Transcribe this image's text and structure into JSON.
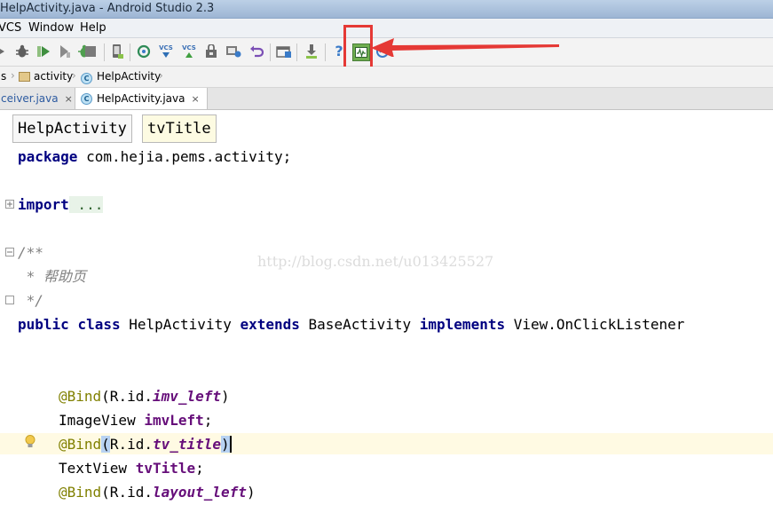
{
  "window": {
    "title": "HelpActivity.java - Android Studio 2.3"
  },
  "menu": {
    "vcs": "VCS",
    "window": "Window",
    "help": "Help"
  },
  "toolbar": {
    "vcs1": "VCS",
    "vcs2": "VCS",
    "help_glyph": "?"
  },
  "nav": {
    "crumb0": "s",
    "crumb1": "activity",
    "crumb2": "HelpActivity",
    "class_badge": "C"
  },
  "tabs": [
    {
      "label": "ceiver.java",
      "close": "×"
    },
    {
      "label": "HelpActivity.java",
      "close": "×",
      "badge": "C"
    }
  ],
  "editor": {
    "crumbs": [
      "HelpActivity",
      "tvTitle"
    ],
    "watermark": "http://blog.csdn.net/u013425527",
    "lines": {
      "l1_kw": "package",
      "l1_rest": " com.hejia.pems.activity;",
      "l2_kw": "import",
      "l2_rest": " ...",
      "l3": "/**",
      "l4": " * 帮助页",
      "l5": " */",
      "l6_a": "public",
      "l6_b": " ",
      "l6_c": "class",
      "l6_d": " HelpActivity ",
      "l6_e": "extends",
      "l6_f": " BaseActivity ",
      "l6_g": "implements",
      "l6_h": " View.OnClickListener",
      "l7_ann": "@Bind",
      "l7_a": "(R.id.",
      "l7_fld": "imv_left",
      "l7_b": ")",
      "l8_type": "ImageView ",
      "l8_fld": "imvLeft",
      "l8_end": ";",
      "l9_ann": "@Bind",
      "l9_p": "(",
      "l9_a": "R.id.",
      "l9_fld": "tv_title",
      "l9_b": ")",
      "l10_type": "TextView ",
      "l10_fld": "tvTitle",
      "l10_end": ";",
      "l11_ann": "@Bind",
      "l11_a": "(R.id.",
      "l11_fld": "layout_left",
      "l11_b": ")"
    }
  },
  "colors": {
    "highlight_box": "#e53935",
    "arrow": "#e53935",
    "caret_line": "#fffae3"
  }
}
